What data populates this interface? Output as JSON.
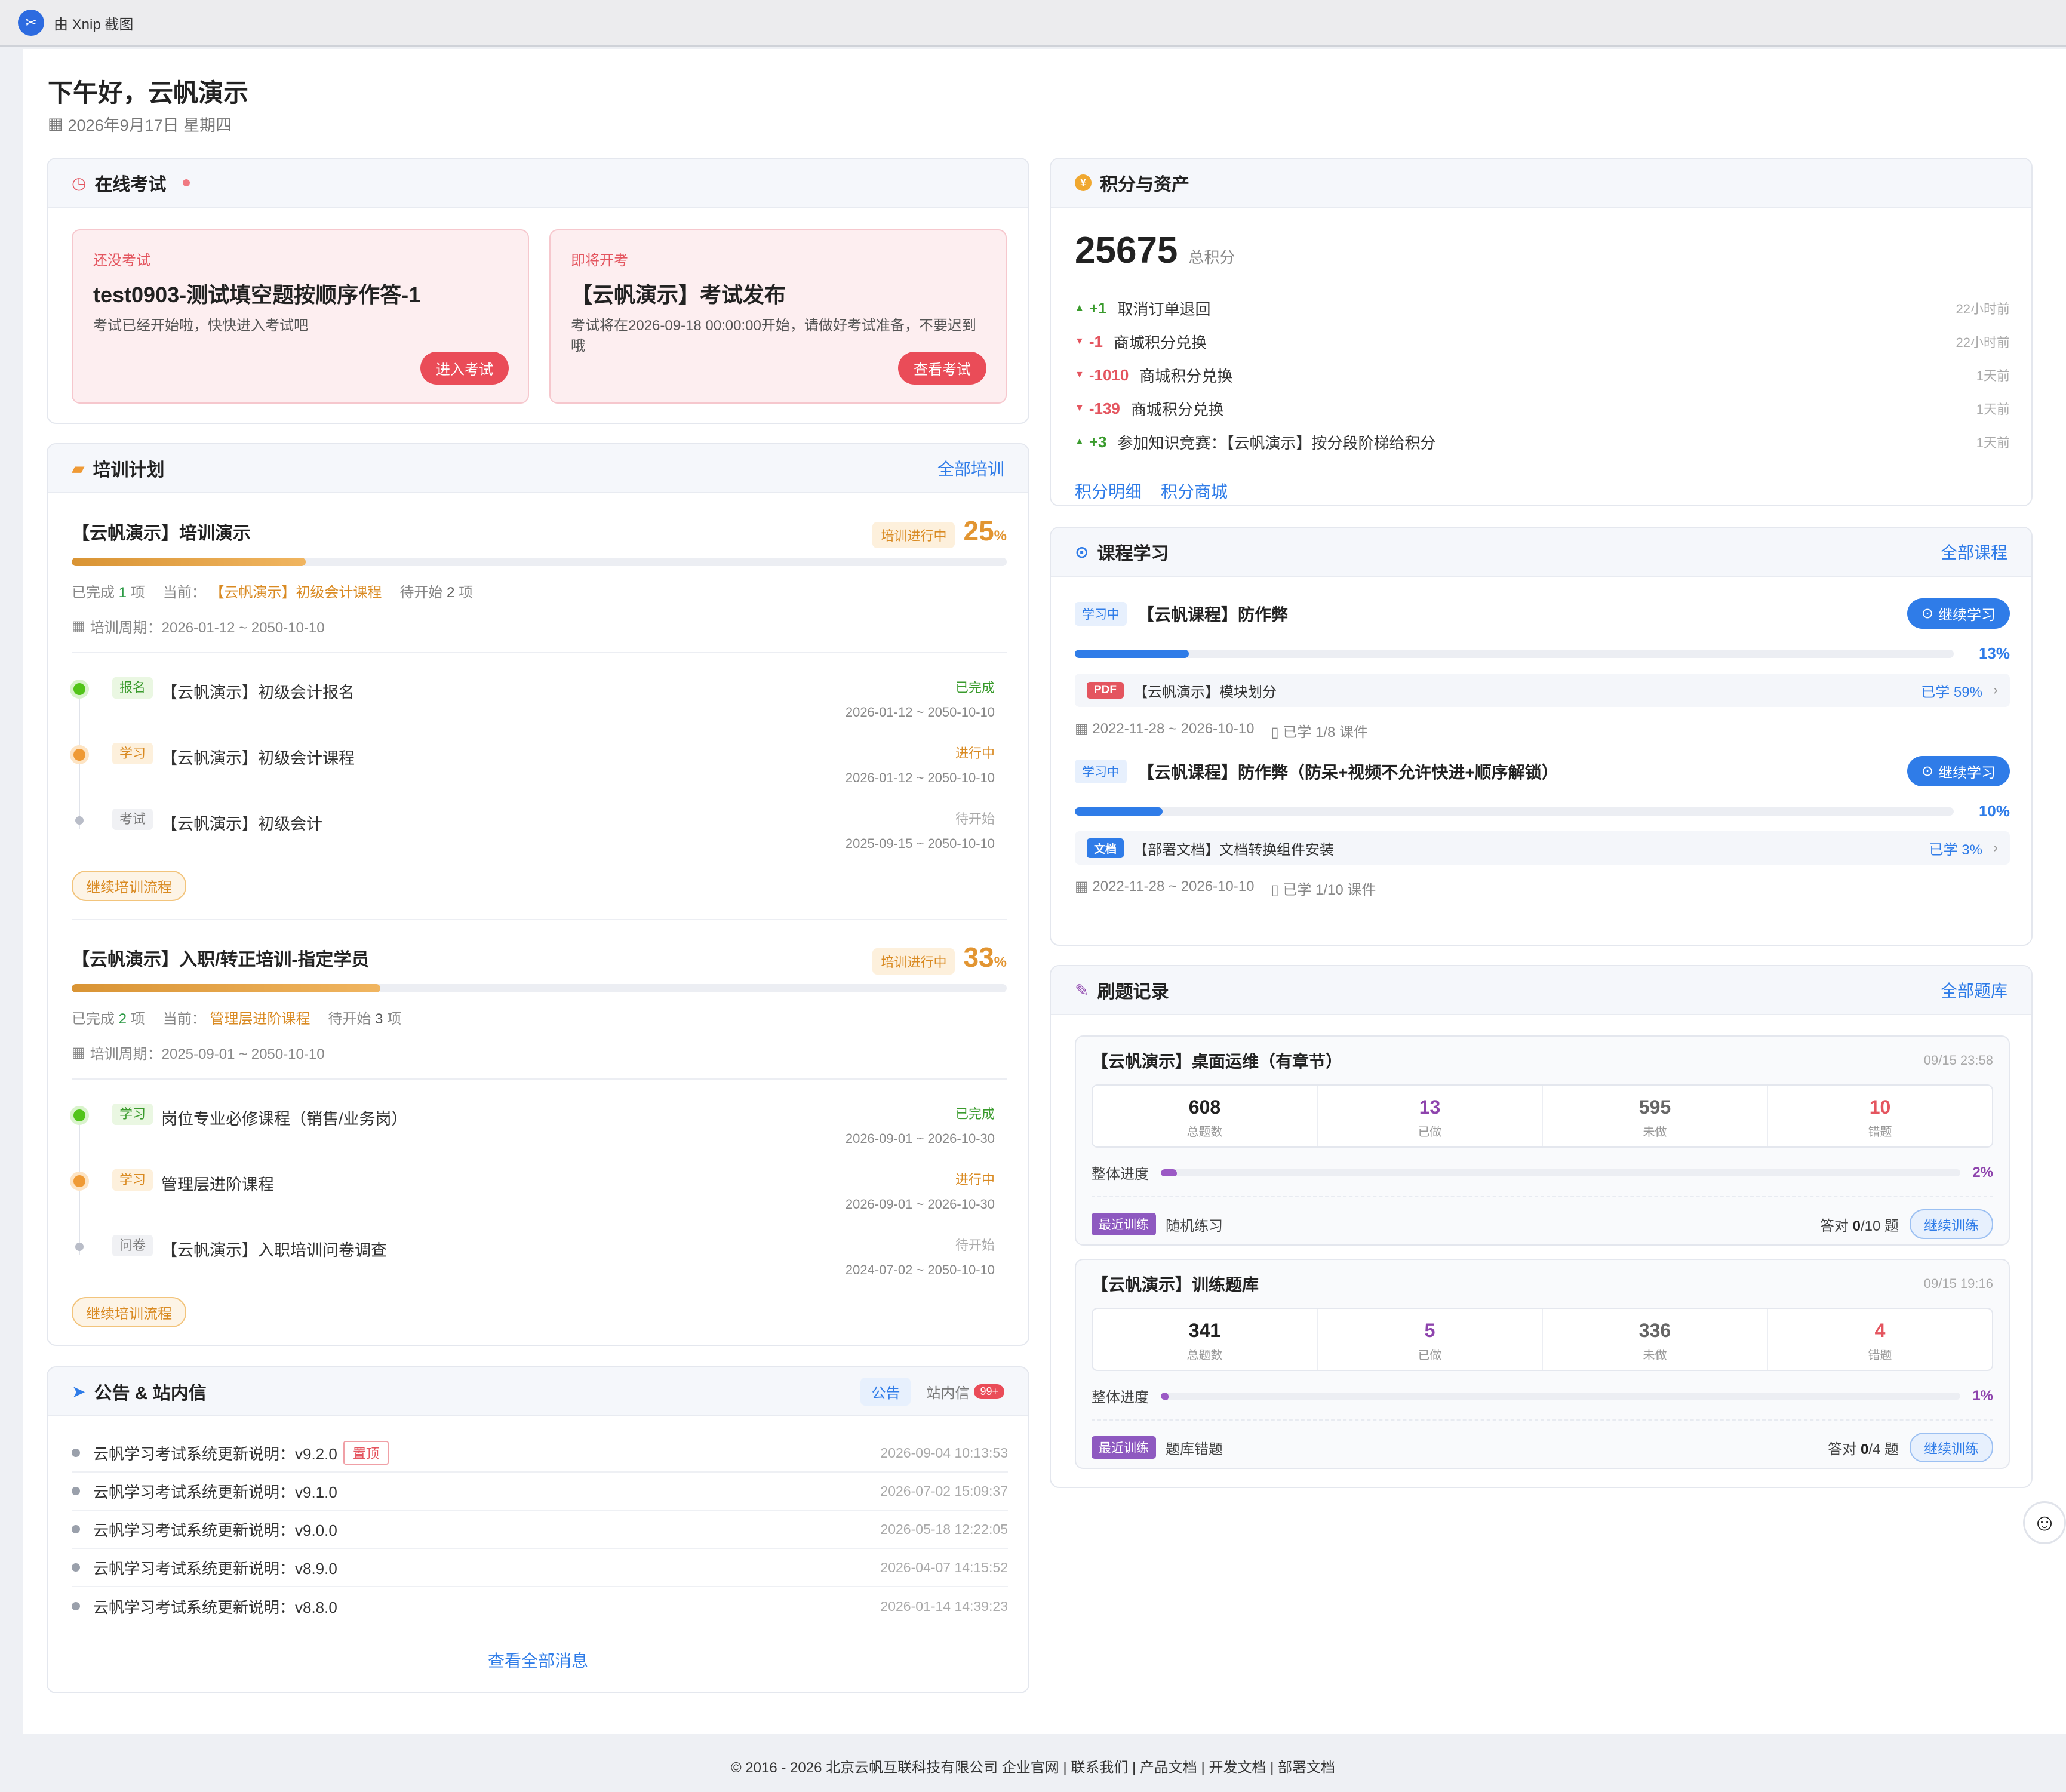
{
  "app": {
    "title": "由 Xnip 截图"
  },
  "header": {
    "greeting": "下午好，云帆演示",
    "date": "2026年9月17日 星期四"
  },
  "exam": {
    "title": "在线考试",
    "cards": [
      {
        "tag": "还没考试",
        "title": "test0903-测试填空题按顺序作答-1",
        "desc": "考试已经开始啦，快快进入考试吧",
        "button": "进入考试"
      },
      {
        "tag": "即将开考",
        "title": "【云帆演示】考试发布",
        "desc": "考试将在2026-09-18 00:00:00开始，请做好考试准备，不要迟到哦",
        "button": "查看考试"
      }
    ]
  },
  "training": {
    "title": "培训计划",
    "more": "全部培训",
    "plans": [
      {
        "name": "【云帆演示】培训演示",
        "status": "培训进行中",
        "percent": "25",
        "percent_unit": "%",
        "progress": 0.25,
        "done_prefix": "已完成",
        "done": "1",
        "done_suffix": "项",
        "current_label": "当前：",
        "current": "【云帆演示】初级会计课程",
        "pending_prefix": "待开始",
        "pending": "2",
        "pending_suffix": "项",
        "period": "培训周期：2026-01-12 ~ 2050-10-10",
        "steps": [
          {
            "tag": "报名",
            "name": "【云帆演示】初级会计报名",
            "status": "已完成",
            "dates": "2026-01-12 ~ 2050-10-10",
            "state": "green"
          },
          {
            "tag": "学习",
            "name": "【云帆演示】初级会计课程",
            "status": "进行中",
            "dates": "2026-01-12 ~ 2050-10-10",
            "state": "orange"
          },
          {
            "tag": "考试",
            "name": "【云帆演示】初级会计",
            "status": "待开始",
            "dates": "2025-09-15 ~ 2050-10-10",
            "state": "gray"
          }
        ],
        "button": "继续培训流程"
      },
      {
        "name": "【云帆演示】入职/转正培训-指定学员",
        "status": "培训进行中",
        "percent": "33",
        "percent_unit": "%",
        "progress": 0.33,
        "done_prefix": "已完成",
        "done": "2",
        "done_suffix": "项",
        "current_label": "当前：",
        "current": "管理层进阶课程",
        "pending_prefix": "待开始",
        "pending": "3",
        "pending_suffix": "项",
        "period": "培训周期：2025-09-01 ~ 2050-10-10",
        "steps": [
          {
            "tag": "学习",
            "name": "岗位专业必修课程（销售/业务岗）",
            "status": "已完成",
            "dates": "2026-09-01 ~ 2026-10-30",
            "state": "green"
          },
          {
            "tag": "学习",
            "name": "管理层进阶课程",
            "status": "进行中",
            "dates": "2026-09-01 ~ 2026-10-30",
            "state": "orange"
          },
          {
            "tag": "问卷",
            "name": "【云帆演示】入职培训问卷调查",
            "status": "待开始",
            "dates": "2024-07-02 ~ 2050-10-10",
            "state": "gray"
          }
        ],
        "button": "继续培训流程"
      }
    ]
  },
  "announcements": {
    "title": "公告 & 站内信",
    "tab_active": "公告",
    "tab_other": "站内信",
    "unread": "99+",
    "pin_label": "置顶",
    "items": [
      {
        "text": "云帆学习考试系统更新说明：v9.2.0",
        "time": "2026-09-04 10:13:53",
        "pinned": true
      },
      {
        "text": "云帆学习考试系统更新说明：v9.1.0",
        "time": "2026-07-02 15:09:37",
        "pinned": false
      },
      {
        "text": "云帆学习考试系统更新说明：v9.0.0",
        "time": "2026-05-18 12:22:05",
        "pinned": false
      },
      {
        "text": "云帆学习考试系统更新说明：v8.9.0",
        "time": "2026-04-07 14:15:52",
        "pinned": false
      },
      {
        "text": "云帆学习考试系统更新说明：v8.8.0",
        "time": "2026-01-14 14:39:23",
        "pinned": false
      }
    ],
    "view_all": "查看全部消息"
  },
  "points": {
    "title": "积分与资产",
    "total": "25675",
    "total_label": "总积分",
    "records": [
      {
        "delta": "+1",
        "dir": "up",
        "text": "取消订单退回",
        "time": "22小时前"
      },
      {
        "delta": "-1",
        "dir": "down",
        "text": "商城积分兑换",
        "time": "22小时前"
      },
      {
        "delta": "-1010",
        "dir": "down",
        "text": "商城积分兑换",
        "time": "1天前"
      },
      {
        "delta": "-139",
        "dir": "down",
        "text": "商城积分兑换",
        "time": "1天前"
      },
      {
        "delta": "+3",
        "dir": "up",
        "text": "参加知识竞赛：【云帆演示】按分段阶梯给积分",
        "time": "1天前"
      }
    ],
    "link_detail": "积分明细",
    "link_mall": "积分商城"
  },
  "courses": {
    "title": "课程学习",
    "more": "全部课程",
    "items": [
      {
        "status": "学习中",
        "name": "【云帆课程】防作弊",
        "button": "继续学习",
        "percent": "13%",
        "progress": 0.13,
        "lesson_type": "PDF",
        "lesson": "【云帆演示】模块划分",
        "lesson_pct": "已学 59%",
        "dates": "2022-11-28 ~ 2026-10-10",
        "learned": "已学 1/8 课件"
      },
      {
        "status": "学习中",
        "name": "【云帆课程】防作弊（防呆+视频不允许快进+顺序解锁）",
        "button": "继续学习",
        "percent": "10%",
        "progress": 0.1,
        "lesson_type": "文档",
        "lesson": "【部署文档】文档转换组件安装",
        "lesson_pct": "已学 3%",
        "dates": "2022-11-28 ~ 2026-10-10",
        "learned": "已学 1/10 课件"
      }
    ]
  },
  "practice": {
    "title": "刷题记录",
    "more": "全部题库",
    "items": [
      {
        "name": "【云帆演示】桌面运维（有章节）",
        "time": "09/15 23:58",
        "total": "608",
        "total_label": "总题数",
        "done": "13",
        "done_label": "已做",
        "undone": "595",
        "undone_label": "未做",
        "wrong": "10",
        "wrong_label": "错题",
        "progress_label": "整体进度",
        "percent": "2%",
        "progress": 0.02,
        "recent_label": "最近训练",
        "recent": "随机练习",
        "correct_prefix": "答对",
        "correct": "0",
        "correct_total": "/10",
        "correct_suffix": "题",
        "button": "继续训练"
      },
      {
        "name": "【云帆演示】训练题库",
        "time": "09/15 19:16",
        "total": "341",
        "total_label": "总题数",
        "done": "5",
        "done_label": "已做",
        "undone": "336",
        "undone_label": "未做",
        "wrong": "4",
        "wrong_label": "错题",
        "progress_label": "整体进度",
        "percent": "1%",
        "progress": 0.01,
        "recent_label": "最近训练",
        "recent": "题库错题",
        "correct_prefix": "答对",
        "correct": "0",
        "correct_total": "/4",
        "correct_suffix": "题",
        "button": "继续训练"
      }
    ]
  },
  "footer": "© 2016 - 2026 北京云帆互联科技有限公司 企业官网 | 联系我们 | 产品文档 | 开发文档 | 部署文档"
}
